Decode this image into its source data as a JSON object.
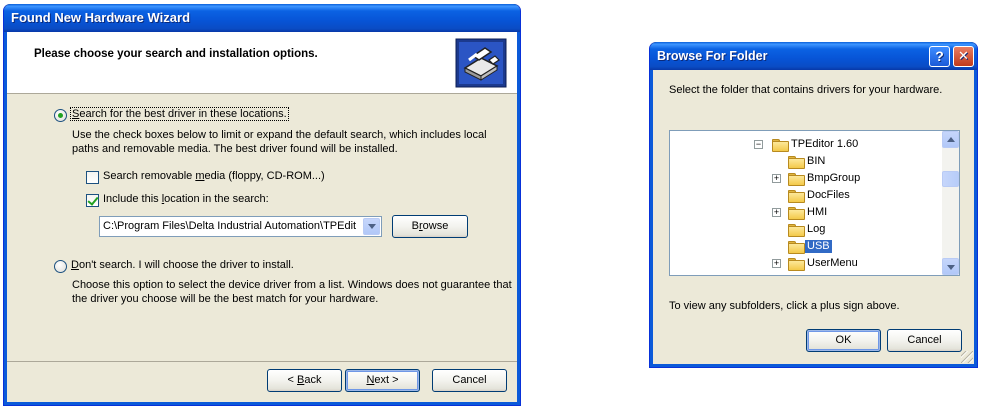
{
  "wizard": {
    "title": "Found New Hardware Wizard",
    "header_title": "Please choose your search and installation options.",
    "header_icon": "hardware-installer-icon",
    "radio_search": {
      "label_key": "S",
      "label_rest": "earch for the best driver in these locations.",
      "selected": true
    },
    "search_description": "Use the check boxes below to limit or expand the default search, which includes local paths and removable media. The best driver found will be installed.",
    "check_removable": {
      "label_pre": "Search removable ",
      "label_key": "m",
      "label_post": "edia (floppy, CD-ROM...)",
      "checked": false
    },
    "check_location": {
      "label_pre": "Include this ",
      "label_key": "l",
      "label_post": "ocation in the search:",
      "checked": true
    },
    "location_value": "C:\\Program Files\\Delta Industrial Automation\\TPEdit",
    "browse_label_key": "r",
    "browse_label_pre": "B",
    "browse_label_post": "owse",
    "radio_dont": {
      "label_key": "D",
      "label_rest": "on't search. I will choose the driver to install.",
      "selected": false
    },
    "dont_description": "Choose this option to select the device driver from a list. Windows does not guarantee that the driver you choose will be the best match for your hardware.",
    "back_pre": "< ",
    "back_key": "B",
    "back_post": "ack",
    "next_key": "N",
    "next_post": "ext >",
    "cancel_label": "Cancel"
  },
  "browse": {
    "title": "Browse For Folder",
    "help_glyph": "?",
    "close_glyph": "✕",
    "instruction": "Select the folder that contains drivers for your hardware.",
    "tree": [
      {
        "name": "TPEditor 1.60",
        "expander": "−",
        "selected": false
      },
      {
        "name": "BIN",
        "expander": "",
        "selected": false
      },
      {
        "name": "BmpGroup",
        "expander": "+",
        "selected": false
      },
      {
        "name": "DocFiles",
        "expander": "",
        "selected": false
      },
      {
        "name": "HMI",
        "expander": "+",
        "selected": false
      },
      {
        "name": "Log",
        "expander": "",
        "selected": false
      },
      {
        "name": "USB",
        "expander": "",
        "selected": true
      },
      {
        "name": "UserMenu",
        "expander": "+",
        "selected": false
      }
    ],
    "hint": "To view any subfolders, click a plus sign above.",
    "ok_label": "OK",
    "cancel_label": "Cancel"
  },
  "colors": {
    "title_bar": "#0754d6",
    "dialog_bg": "#ece9d8",
    "selection": "#316ac5"
  }
}
